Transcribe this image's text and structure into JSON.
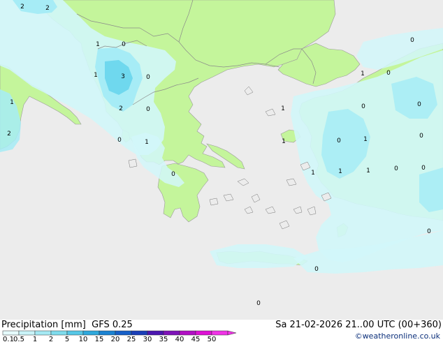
{
  "map": {
    "colors": {
      "sea": "#ececec",
      "land": "#c4f59b",
      "precip_light": "#d2f7fa",
      "precip_mid": "#a6ecf6",
      "precip_strong": "#6fd8ee",
      "border": "#8a8a8a",
      "coast": "#9a9a9a"
    },
    "value_labels": [
      "2",
      "2",
      "1",
      "0",
      "1",
      "3",
      "0",
      "1",
      "2",
      "0",
      "2",
      "0",
      "1",
      "0",
      "0",
      "1",
      "0",
      "0",
      "0",
      "1",
      "1",
      "0",
      "1",
      "0",
      "1",
      "1",
      "0",
      "0",
      "1",
      "0",
      "0",
      "0"
    ]
  },
  "footer": {
    "title_left": "Precipitation [mm]  GFS 0.25",
    "title_right": "Sa 21-02-2026 21..00 UTC (00+360)",
    "credit": "©weatheronline.co.uk"
  },
  "legend": {
    "ticks": [
      "0.1",
      "0.5",
      "1",
      "2",
      "5",
      "10",
      "15",
      "20",
      "25",
      "30",
      "35",
      "40",
      "45",
      "50"
    ],
    "colors": [
      "#e6fbfc",
      "#c9f3f8",
      "#a5e9f3",
      "#7fdced",
      "#56c7e6",
      "#2fa8dc",
      "#1b83d2",
      "#165fc8",
      "#1a3fb8",
      "#4b16b0",
      "#7e12b8",
      "#b10fc4",
      "#dd10d4",
      "#f033e6"
    ]
  }
}
